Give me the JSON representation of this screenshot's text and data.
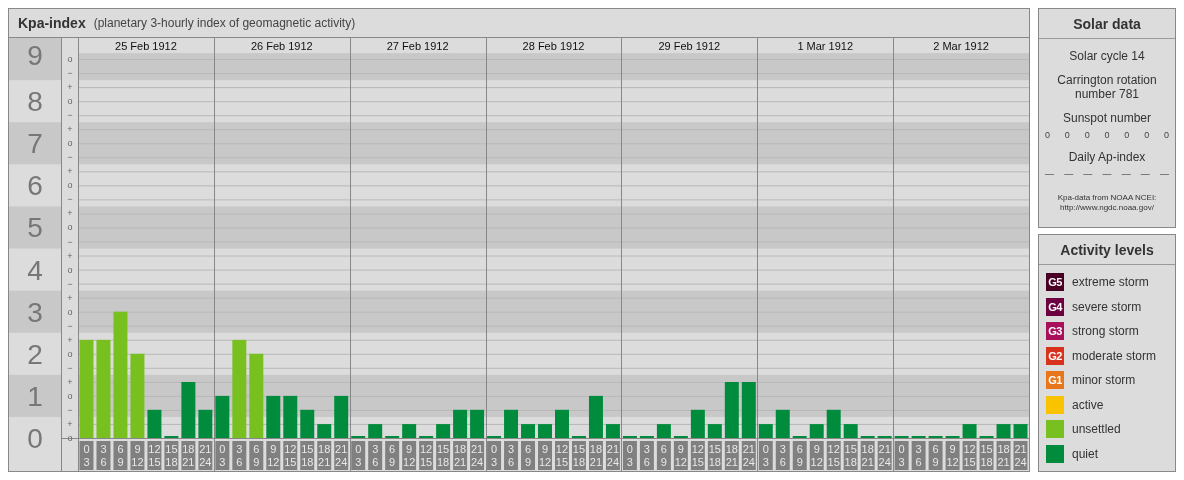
{
  "chart_panel": {
    "title": "Kpa-index",
    "subtitle": "(planetary 3-hourly index of geomagnetic activity)",
    "days": [
      "25 Feb 1912",
      "26 Feb 1912",
      "27 Feb 1912",
      "28 Feb 1912",
      "29 Feb 1912",
      "1 Mar 1912",
      "2 Mar 1912"
    ],
    "sublevel_marks": [
      "o",
      "−",
      "+",
      "o",
      "−",
      "+",
      "o",
      "−",
      "+",
      "o",
      "−",
      "+",
      "o",
      "−",
      "+",
      "o",
      "−",
      "+",
      "o",
      "−",
      "+",
      "o",
      "−",
      "+",
      "o",
      "−",
      "+",
      "o"
    ],
    "chart_data": {
      "type": "bar",
      "stacked": true,
      "grid": true,
      "ylim": [
        0,
        9.5
      ],
      "bands": [
        {
          "axis": "y",
          "from": 0.5,
          "to": 1.5,
          "color": "#c8c8c8"
        },
        {
          "axis": "y",
          "from": 2.5,
          "to": 3.5,
          "color": "#c8c8c8"
        },
        {
          "axis": "y",
          "from": 4.5,
          "to": 5.5,
          "color": "#c8c8c8"
        },
        {
          "axis": "y",
          "from": 6.5,
          "to": 7.5,
          "color": "#c8c8c8"
        },
        {
          "axis": "y",
          "from": 8.5,
          "to": 9.14,
          "color": "#c8c8c8"
        }
      ],
      "yticks": [
        {
          "value": 0,
          "label": "0"
        },
        {
          "value": 1,
          "label": "1"
        },
        {
          "value": 2,
          "label": "2"
        },
        {
          "value": 3,
          "label": "3"
        },
        {
          "value": 4,
          "label": "4"
        },
        {
          "value": 5,
          "label": "5"
        },
        {
          "value": 6,
          "label": "6"
        },
        {
          "value": 7,
          "label": "7"
        },
        {
          "value": 8,
          "label": "8"
        },
        {
          "value": 9,
          "label": "9"
        }
      ],
      "categories": [
        "0 3",
        "3 6",
        "6 9",
        "9 12",
        "12 15",
        "15 18",
        "18 21",
        "21 24",
        "0 3",
        "3 6",
        "6 9",
        "9 12",
        "12 15",
        "15 18",
        "18 21",
        "21 24",
        "0 3",
        "3 6",
        "6 9",
        "9 12",
        "12 15",
        "15 18",
        "18 21",
        "21 24",
        "0 3",
        "3 6",
        "6 9",
        "9 12",
        "12 15",
        "15 18",
        "18 21",
        "21 24",
        "0 3",
        "3 6",
        "6 9",
        "9 12",
        "12 15",
        "15 18",
        "18 21",
        "21 24",
        "0 3",
        "3 6",
        "6 9",
        "9 12",
        "12 15",
        "15 18",
        "18 21",
        "21 24",
        "0 3",
        "3 6",
        "6 9",
        "9 12",
        "12 15",
        "15 18",
        "18 21",
        "21 24"
      ],
      "series": [
        {
          "color": "#008c3c",
          "values": [
            null,
            null,
            null,
            null,
            0.67,
            0,
            1.33,
            0.67,
            1,
            null,
            null,
            1,
            1,
            0.67,
            0.33,
            1,
            0,
            0.33,
            0,
            0.33,
            0,
            0.33,
            0.67,
            0.67,
            0,
            0.67,
            0.33,
            0.33,
            0.67,
            0,
            1,
            0.33,
            0,
            0,
            0.33,
            0,
            0.67,
            0.33,
            1.33,
            1.33,
            0.33,
            0.67,
            0,
            0.33,
            0.67,
            0.33,
            0,
            0,
            0,
            0,
            0,
            0,
            0.33,
            0,
            0.33,
            0.33
          ]
        },
        {
          "color": "#78c020",
          "values": [
            2.33,
            2.33,
            3,
            2,
            null,
            null,
            null,
            null,
            null,
            2.33,
            2,
            null,
            null,
            null,
            null,
            null,
            null,
            null,
            null,
            null,
            null,
            null,
            null,
            null,
            null,
            null,
            null,
            null,
            null,
            null,
            null,
            null,
            null,
            null,
            null,
            null,
            null,
            null,
            null,
            null,
            null,
            null,
            null,
            null,
            null,
            null,
            null,
            null,
            null,
            null,
            null,
            null,
            null,
            null,
            null,
            null
          ]
        }
      ]
    }
  },
  "solar_data": {
    "title": "Solar data",
    "solar_cycle": "Solar cycle 14",
    "carrington": "Carrington rotation number 781",
    "sunspot_label": "Sunspot number",
    "sunspot_values": [
      "0",
      "0",
      "0",
      "0",
      "0",
      "0",
      "0"
    ],
    "ap_label": "Daily Ap-index",
    "ap_values": [
      "—",
      "—",
      "—",
      "—",
      "—",
      "—",
      "—"
    ],
    "source": "Kpa-data from NOAA NCEI:",
    "source_url": "http://www.ngdc.noaa.gov/"
  },
  "activity_levels": {
    "title": "Activity levels",
    "items": [
      {
        "badge": "G5",
        "label": "extreme storm",
        "color": "#4a0024"
      },
      {
        "badge": "G4",
        "label": "severe storm",
        "color": "#6c0040"
      },
      {
        "badge": "G3",
        "label": "strong storm",
        "color": "#a8105c"
      },
      {
        "badge": "G2",
        "label": "moderate storm",
        "color": "#d8321c"
      },
      {
        "badge": "G1",
        "label": "minor storm",
        "color": "#e8761a"
      },
      {
        "label": "active",
        "color": "#fac300"
      },
      {
        "label": "unsettled",
        "color": "#78c020"
      },
      {
        "label": "quiet",
        "color": "#008c3c"
      }
    ]
  }
}
